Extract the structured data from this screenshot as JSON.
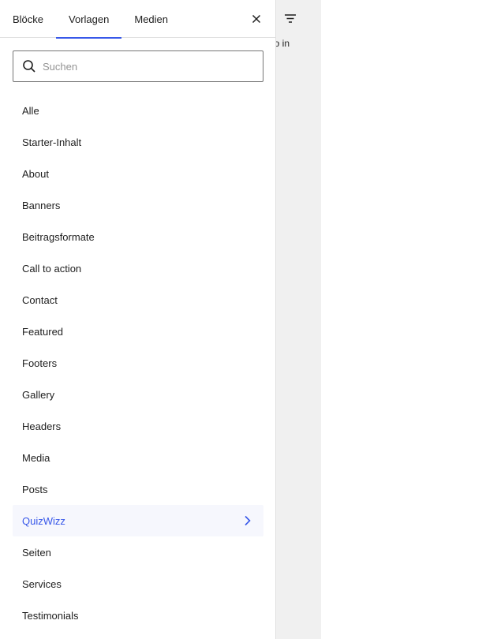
{
  "tabs": [
    {
      "label": "Blöcke"
    },
    {
      "label": "Vorlagen"
    },
    {
      "label": "Medien"
    }
  ],
  "active_tab": 1,
  "search": {
    "placeholder": "Suchen",
    "value": ""
  },
  "categories": [
    {
      "label": "Alle"
    },
    {
      "label": "Starter-Inhalt"
    },
    {
      "label": "About"
    },
    {
      "label": "Banners"
    },
    {
      "label": "Beitragsformate"
    },
    {
      "label": "Call to action"
    },
    {
      "label": "Contact"
    },
    {
      "label": "Featured"
    },
    {
      "label": "Footers"
    },
    {
      "label": "Gallery"
    },
    {
      "label": "Headers"
    },
    {
      "label": "Media"
    },
    {
      "label": "Posts"
    },
    {
      "label": "QuizWizz"
    },
    {
      "label": "Seiten"
    },
    {
      "label": "Services"
    },
    {
      "label": "Testimonials"
    }
  ],
  "selected_category": 13,
  "background_fragment": "o in",
  "colors": {
    "accent": "#3858e9",
    "selected_bg": "#f6f7fd",
    "strip_bg": "#f0f0f0"
  },
  "icons": {
    "close": "close-icon",
    "search": "search-icon",
    "filter": "filter-icon",
    "chevron": "chevron-right-icon"
  }
}
